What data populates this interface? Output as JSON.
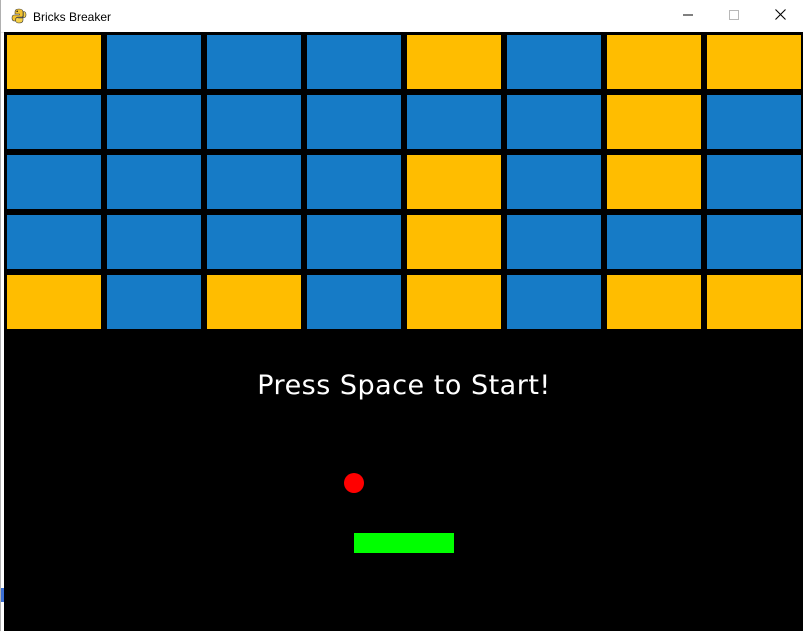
{
  "window": {
    "title": "Bricks Breaker",
    "controls": {
      "minimize_icon": "minimize-icon",
      "maximize_icon": "maximize-icon",
      "close_icon": "close-icon"
    }
  },
  "game": {
    "prompt": "Press Space to Start!",
    "colors": {
      "background": "#000000",
      "brick_blue": "#167BC6",
      "brick_yellow": "#FFBD00",
      "ball": "#FF0000",
      "paddle": "#00FF00"
    },
    "bricks": [
      [
        "yellow",
        "blue",
        "blue",
        "blue",
        "yellow",
        "blue",
        "yellow",
        "yellow"
      ],
      [
        "blue",
        "blue",
        "blue",
        "blue",
        "blue",
        "blue",
        "yellow",
        "blue"
      ],
      [
        "blue",
        "blue",
        "blue",
        "blue",
        "yellow",
        "blue",
        "yellow",
        "blue"
      ],
      [
        "blue",
        "blue",
        "blue",
        "blue",
        "yellow",
        "blue",
        "blue",
        "blue"
      ],
      [
        "yellow",
        "blue",
        "yellow",
        "blue",
        "yellow",
        "blue",
        "yellow",
        "yellow"
      ]
    ]
  }
}
